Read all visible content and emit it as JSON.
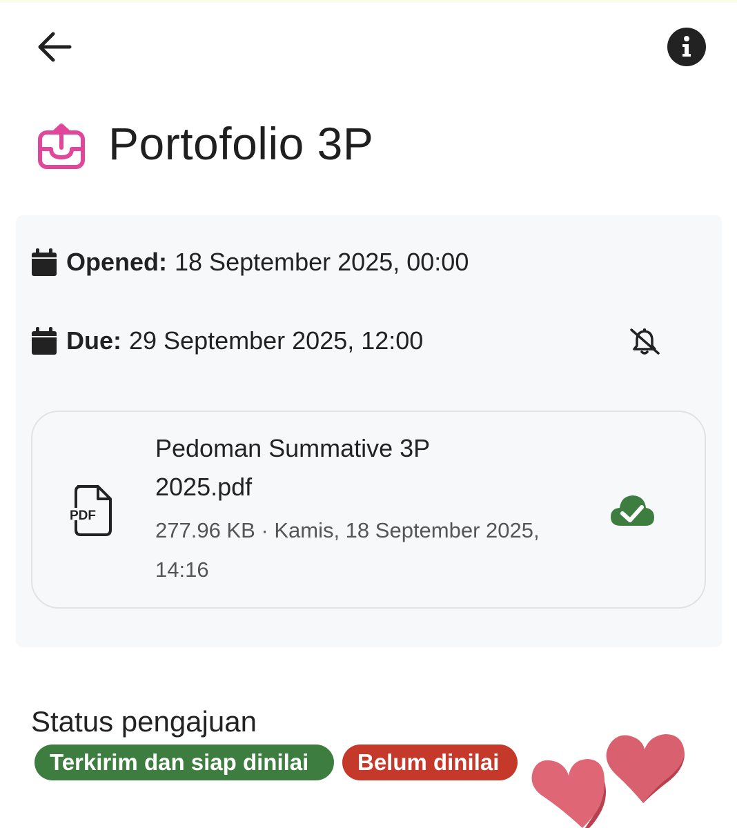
{
  "header": {
    "back_icon": "arrow-left-icon",
    "info_icon": "info-circle-icon"
  },
  "assignment": {
    "icon": "inbox-upload-icon",
    "title": "Portofolio 3P",
    "accent_color": "#e0479a"
  },
  "dates": {
    "opened_label": "Opened:",
    "opened_value": "18 September 2025, 00:00",
    "due_label": "Due:",
    "due_value": "29 September 2025, 12:00",
    "calendar_icon": "calendar-icon",
    "reminder_icon": "bell-slash-icon"
  },
  "attachment": {
    "icon": "pdf-file-icon",
    "file_name": "Pedoman Summative 3P 2025.pdf",
    "meta": "277.96 KB · Kamis, 18 September 2025, 14:16",
    "status_icon": "cloud-check-icon",
    "status_color": "#3d7d3f"
  },
  "submission": {
    "heading": "Status pengajuan",
    "badges": [
      {
        "label": "Terkirim dan siap dinilai",
        "color": "#3d7d3f"
      },
      {
        "label": "Belum dinilai",
        "color": "#c4392a"
      }
    ]
  },
  "decoration": {
    "icon": "hearts-sticker-icon"
  }
}
